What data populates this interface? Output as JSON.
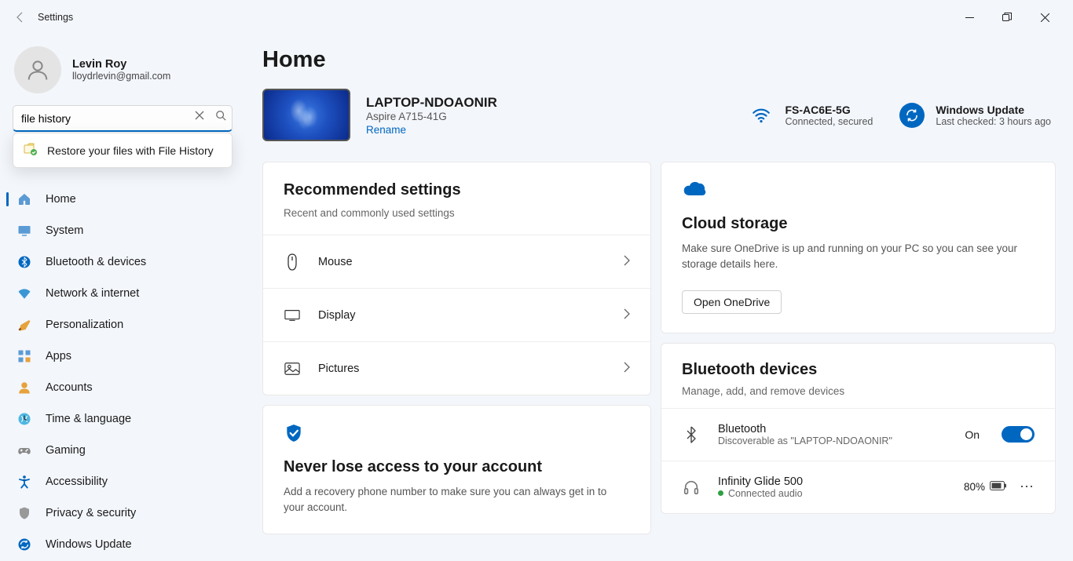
{
  "window": {
    "title": "Settings"
  },
  "profile": {
    "name": "Levin Roy",
    "email": "lloydrlevin@gmail.com"
  },
  "search": {
    "value": "file history",
    "result": "Restore your files with File History"
  },
  "nav": {
    "items": [
      {
        "label": "Home",
        "key": "home"
      },
      {
        "label": "System",
        "key": "system"
      },
      {
        "label": "Bluetooth & devices",
        "key": "bluetooth"
      },
      {
        "label": "Network & internet",
        "key": "network"
      },
      {
        "label": "Personalization",
        "key": "personalization"
      },
      {
        "label": "Apps",
        "key": "apps"
      },
      {
        "label": "Accounts",
        "key": "accounts"
      },
      {
        "label": "Time & language",
        "key": "time"
      },
      {
        "label": "Gaming",
        "key": "gaming"
      },
      {
        "label": "Accessibility",
        "key": "accessibility"
      },
      {
        "label": "Privacy & security",
        "key": "privacy"
      },
      {
        "label": "Windows Update",
        "key": "update"
      }
    ],
    "selected": 0
  },
  "page": {
    "title": "Home"
  },
  "device": {
    "name": "LAPTOP-NDOAONIR",
    "model": "Aspire A715-41G",
    "rename_label": "Rename"
  },
  "status": {
    "wifi": {
      "label": "FS-AC6E-5G",
      "sub": "Connected, secured"
    },
    "update": {
      "label": "Windows Update",
      "sub": "Last checked: 3 hours ago"
    }
  },
  "recommended": {
    "title": "Recommended settings",
    "sub": "Recent and commonly used settings",
    "items": [
      "Mouse",
      "Display",
      "Pictures"
    ]
  },
  "cloud": {
    "title": "Cloud storage",
    "text": "Make sure OneDrive is up and running on your PC so you can see your storage details here.",
    "button": "Open OneDrive"
  },
  "bluetooth": {
    "title": "Bluetooth devices",
    "sub": "Manage, add, and remove devices",
    "toggle": {
      "title": "Bluetooth",
      "sub": "Discoverable as \"LAPTOP-NDOAONIR\"",
      "on_label": "On",
      "state": true
    },
    "device": {
      "name": "Infinity Glide 500",
      "status": "Connected audio",
      "battery": "80%"
    }
  },
  "account_card": {
    "title": "Never lose access to your account",
    "text": "Add a recovery phone number to make sure you can always get in to your account."
  },
  "colors": {
    "accent": "#0067c0"
  }
}
